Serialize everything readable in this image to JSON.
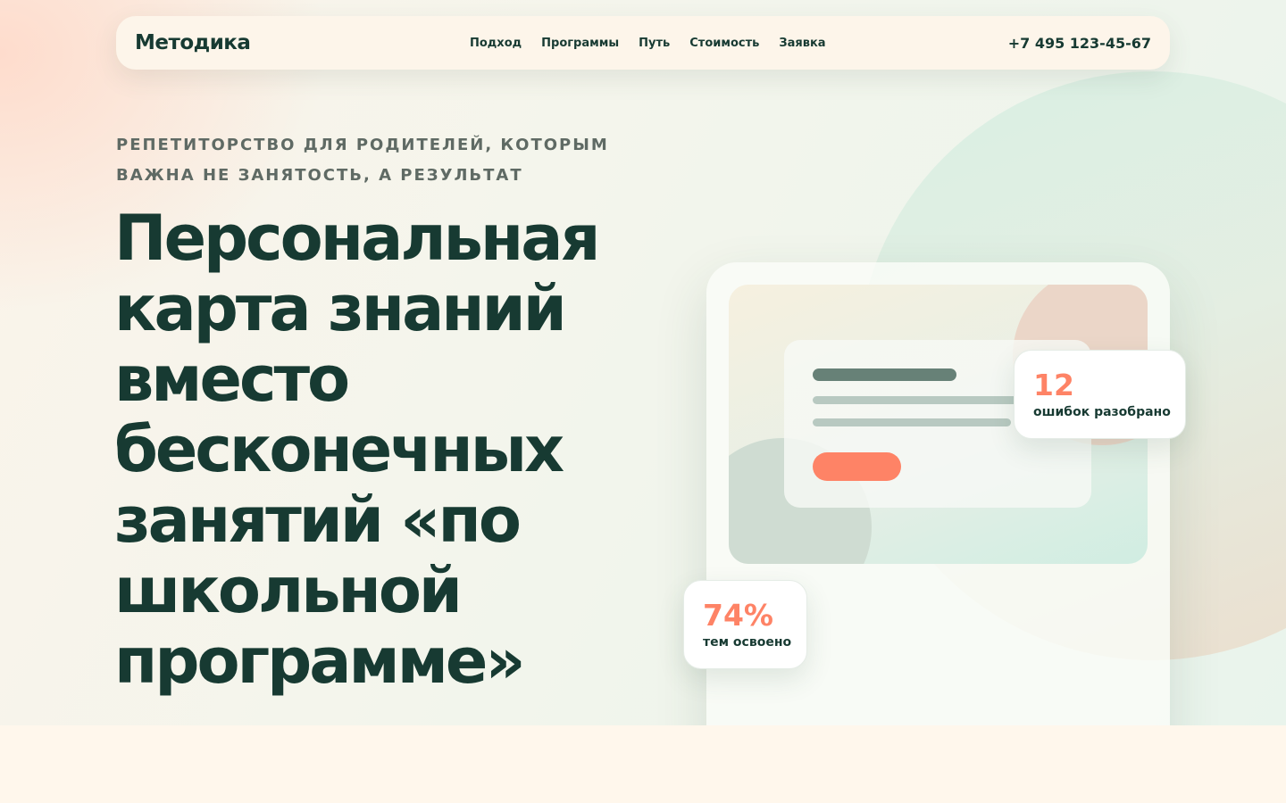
{
  "brand": {
    "logo": "Методика"
  },
  "nav": {
    "items": [
      "Подход",
      "Программы",
      "Путь",
      "Стоимость",
      "Заявка"
    ],
    "phone": "+7 495 123-45-67"
  },
  "hero": {
    "eyebrow": "РЕПЕТИТОРСТВО ДЛЯ РОДИТЕЛЕЙ, КОТОРЫМ ВАЖНА НЕ ЗАНЯТОСТЬ, А РЕЗУЛЬТАТ",
    "headline": "Персональная карта знаний вместо бесконечных занятий «по школьной программе»"
  },
  "stats": [
    {
      "value": "12",
      "label": "ошибок разобрано"
    },
    {
      "value": "74%",
      "label": "тем освоено"
    }
  ],
  "colors": {
    "accent": "#fe8366",
    "text": "#173a32",
    "muted": "#5f6a64"
  }
}
